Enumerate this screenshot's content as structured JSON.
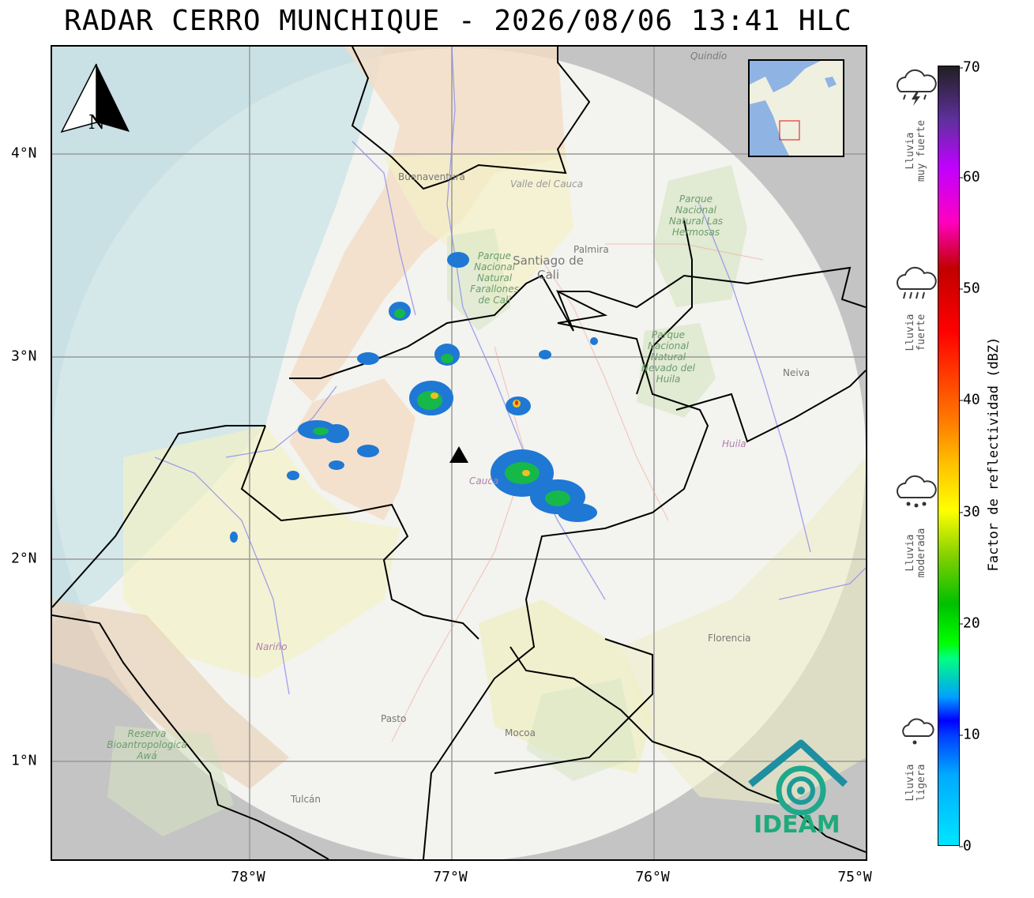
{
  "title": "RADAR CERRO MUNCHIQUE - 2026/08/06 13:41 HLC",
  "map": {
    "north_arrow_label": "N",
    "lon_ticks": [
      "78°W",
      "77°W",
      "76°W",
      "75°W"
    ],
    "lat_ticks": [
      "4°N",
      "3°N",
      "2°N",
      "1°N"
    ],
    "place_labels": {
      "buenaventura": "Buenaventura",
      "valle": "Valle del Cauca",
      "palmira": "Palmira",
      "cali": "Santiago de Cali",
      "quindio": "Quindío",
      "parque_hermosas": "Parque Nacional Natural Las Hermosas",
      "parque_farallones": "Parque Nacional Natural Farallones de Cali",
      "parque_nevado": "Parque Nacional Natural Nevado del Huila",
      "neiva": "Neiva",
      "huila": "Huila",
      "cauca": "Cauca",
      "narino": "Nariño",
      "florencia": "Florencia",
      "pasto": "Pasto",
      "mocoa": "Mocoa",
      "tulcan": "Tulcán",
      "reserva": "Reserva Bioantropologica Awá"
    },
    "logo_text": "IDEAM"
  },
  "colorbar": {
    "label": "Factor de reflectividad (dBZ)",
    "ticks": [
      "0",
      "10",
      "20",
      "30",
      "40",
      "50",
      "60",
      "70"
    ],
    "range": [
      0,
      70
    ]
  },
  "rain_categories": [
    {
      "line1": "Lluvia",
      "line2": "muy fuerte",
      "icon": "storm-cloud-icon"
    },
    {
      "line1": "Lluvia",
      "line2": "fuerte",
      "icon": "heavy-rain-cloud-icon"
    },
    {
      "line1": "Lluvia",
      "line2": "moderada",
      "icon": "rain-cloud-icon"
    },
    {
      "line1": "Lluvia",
      "line2": "ligera",
      "icon": "light-rain-cloud-icon"
    }
  ]
}
